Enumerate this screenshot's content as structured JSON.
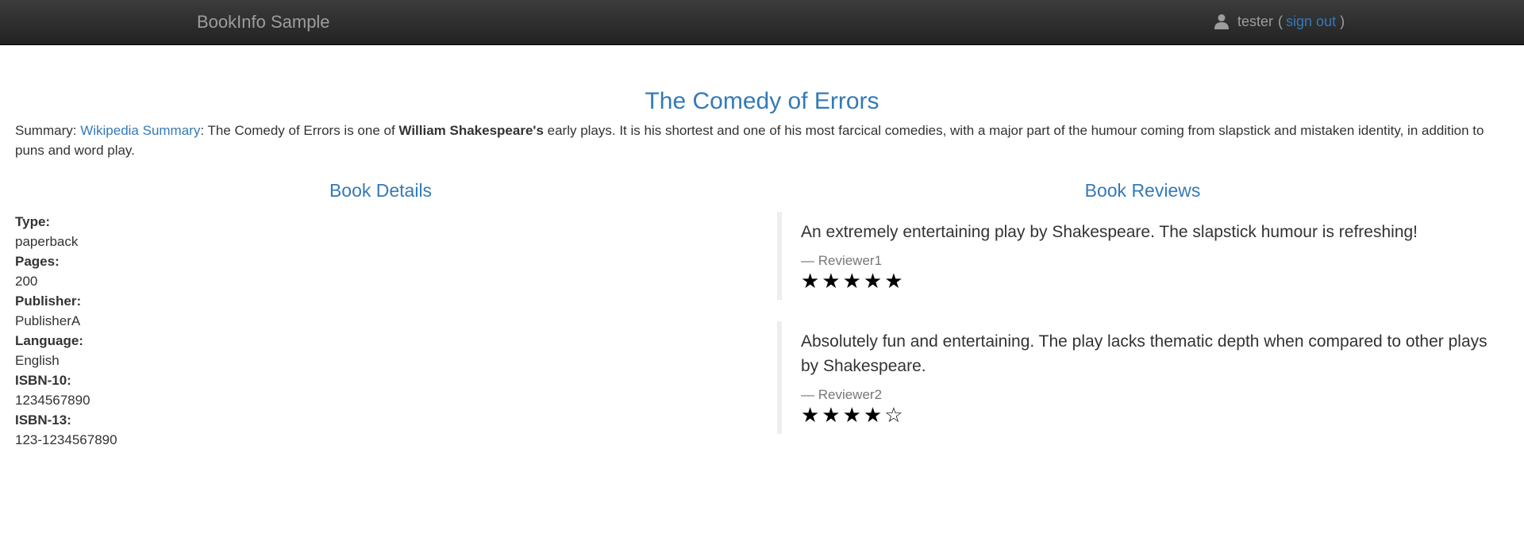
{
  "navbar": {
    "brand": "BookInfo Sample",
    "user": "tester",
    "open_paren": "(",
    "sign_out": "sign out",
    "close_paren": ")"
  },
  "book": {
    "title": "The Comedy of Errors",
    "summary_prefix": "Summary: ",
    "summary_link": "Wikipedia Summary",
    "summary_part1": ": The Comedy of Errors is one of ",
    "summary_bold": "William Shakespeare's",
    "summary_part2": " early plays. It is his shortest and one of his most farcical comedies, with a major part of the humour coming from slapstick and mistaken identity, in addition to puns and word play."
  },
  "details": {
    "heading": "Book Details",
    "items": [
      {
        "label": "Type:",
        "value": "paperback"
      },
      {
        "label": "Pages:",
        "value": "200"
      },
      {
        "label": "Publisher:",
        "value": "PublisherA"
      },
      {
        "label": "Language:",
        "value": "English"
      },
      {
        "label": "ISBN-10:",
        "value": "1234567890"
      },
      {
        "label": "ISBN-13:",
        "value": "123-1234567890"
      }
    ]
  },
  "reviews": {
    "heading": "Book Reviews",
    "items": [
      {
        "text": "An extremely entertaining play by Shakespeare. The slapstick humour is refreshing!",
        "reviewer": "— Reviewer1",
        "rating": 5,
        "stars": "★★★★★"
      },
      {
        "text": "Absolutely fun and entertaining. The play lacks thematic depth when compared to other plays by Shakespeare.",
        "reviewer": "— Reviewer2",
        "rating": 4,
        "stars": "★★★★☆"
      }
    ]
  },
  "icons": {
    "user": "user-icon",
    "star_filled": "star-filled-icon",
    "star_empty": "star-empty-icon"
  },
  "colors": {
    "link": "#337ab7",
    "navbar_bg": "#222222",
    "navbar_text": "#9d9d9d",
    "review_border": "#eeeeee"
  }
}
